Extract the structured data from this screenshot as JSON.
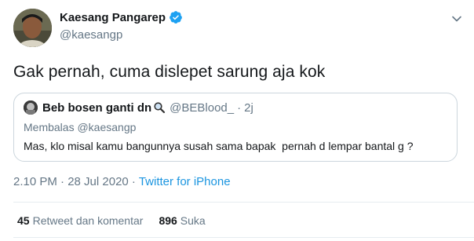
{
  "author": {
    "display_name": "Kaesang Pangarep",
    "handle": "@kaesangp"
  },
  "tweet": {
    "text": "Gak pernah, cuma dislepet sarung aja kok"
  },
  "quoted": {
    "name": "Beb bosen ganti dn",
    "handle": "@BEBlood_",
    "separator": "·",
    "time": "2j",
    "reply_to": "Membalas @kaesangp",
    "text": "Mas, klo misal kamu bangunnya susah sama bapak  pernah d lempar bantal g ?"
  },
  "meta": {
    "timestamp": "2.10 PM · 28 Jul 2020 · ",
    "source": "Twitter for iPhone"
  },
  "stats": {
    "retweets_count": "45",
    "retweets_label": "Retweet dan komentar",
    "likes_count": "896",
    "likes_label": "Suka"
  },
  "colors": {
    "link": "#1b95e0",
    "secondary_text": "#657786",
    "verified": "#1da1f2"
  },
  "icons": [
    "verified-badge-icon",
    "chevron-down-icon",
    "magnifier-icon"
  ]
}
